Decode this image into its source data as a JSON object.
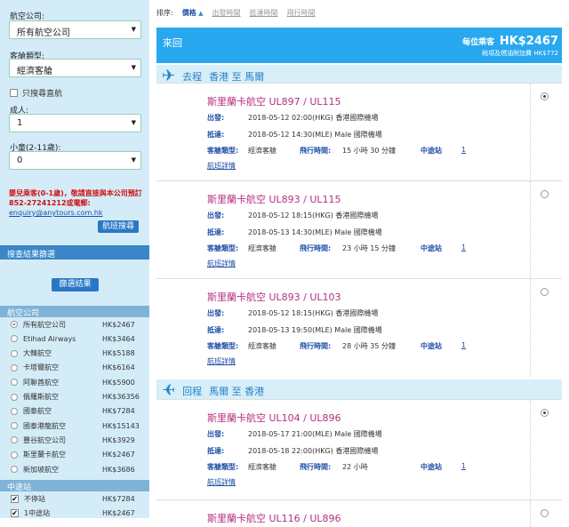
{
  "sidebar": {
    "airline_label": "航空公司:",
    "airline_value": "所有航空公司",
    "cabin_label": "客艙類型:",
    "cabin_value": "經濟客艙",
    "direct_only_label": "只搜尋直航",
    "adult_label": "成人:",
    "adult_value": "1",
    "child_label": "小童(2-11歲):",
    "child_value": "0",
    "notice_red": "嬰兒乘客(0-1歲)，敬請直接與本公司預訂852-27241212或電郵:",
    "notice_email": "enquiry@anytours.com.hk",
    "search_button": "航班搜尋",
    "filter_section_title": "搜查結果篩選",
    "filter_button": "篩選結果",
    "airline_section_title": "航空公司",
    "airlines": [
      {
        "name": "所有航空公司",
        "price": "HK$2467",
        "checked": true
      },
      {
        "name": "Etihad Airways",
        "price": "HK$3464",
        "checked": false
      },
      {
        "name": "大韓航空",
        "price": "HK$5188",
        "checked": false
      },
      {
        "name": "卡塔爾航空",
        "price": "HK$6164",
        "checked": false
      },
      {
        "name": "阿聯酋航空",
        "price": "HK$5900",
        "checked": false
      },
      {
        "name": "俄羅斯航空",
        "price": "HK$36356",
        "checked": false
      },
      {
        "name": "國泰航空",
        "price": "HK$7284",
        "checked": false
      },
      {
        "name": "國泰港龍航空",
        "price": "HK$15143",
        "checked": false
      },
      {
        "name": "豐谷航空公司",
        "price": "HK$3929",
        "checked": false
      },
      {
        "name": "斯里蘭卡航空",
        "price": "HK$2467",
        "checked": false
      },
      {
        "name": "新加坡航空",
        "price": "HK$3686",
        "checked": false
      }
    ],
    "stops_section_title": "中途站",
    "stops": [
      {
        "name": "不停站",
        "price": "HK$7284",
        "checked": true
      },
      {
        "name": "1中途站",
        "price": "HK$2467",
        "checked": true
      }
    ]
  },
  "sortbar": {
    "label": "排序:",
    "options": [
      "價格",
      "出發時間",
      "抵達時間",
      "飛行時間"
    ]
  },
  "header": {
    "title": "來回",
    "price_label": "每位乘客",
    "price": "HK$2467",
    "tax_note": "稅項及燃油附加費",
    "tax": "HK$772"
  },
  "outbound": {
    "label": "去程",
    "from": "香港",
    "to_word": "至",
    "to": "馬爾"
  },
  "inbound": {
    "label": "回程",
    "from": "馬爾",
    "to_word": "至",
    "to": "香港"
  },
  "labels": {
    "depart": "出發:",
    "arrive": "抵達:",
    "cabin": "客艙類型:",
    "duration": "飛行時間:",
    "stop": "中途站",
    "details": "航班詳情"
  },
  "flights": [
    {
      "name": "斯里蘭卡航空 UL897 / UL115",
      "depart": "2018-05-12 02:00(HKG) 香港國際機場",
      "arrive": "2018-05-12 14:30(MLE) Male 國際機場",
      "cabin": "經濟客艙",
      "duration": "15 小時 30 分鐘",
      "stops": "1",
      "selected": true
    },
    {
      "name": "斯里蘭卡航空 UL893 / UL115",
      "depart": "2018-05-12 18:15(HKG) 香港國際機場",
      "arrive": "2018-05-13 14:30(MLE) Male 國際機場",
      "cabin": "經濟客艙",
      "duration": "23 小時 15 分鐘",
      "stops": "1",
      "selected": false
    },
    {
      "name": "斯里蘭卡航空 UL893 / UL103",
      "depart": "2018-05-12 18:15(HKG) 香港國際機場",
      "arrive": "2018-05-13 19:50(MLE) Male 國際機場",
      "cabin": "經濟客艙",
      "duration": "28 小時 35 分鐘",
      "stops": "1",
      "selected": false
    },
    {
      "name": "斯里蘭卡航空 UL104 / UL896",
      "depart": "2018-05-17 21:00(MLE) Male 國際機場",
      "arrive": "2018-05-18 22:00(HKG) 香港國際機場",
      "cabin": "經濟客艙",
      "duration": "22 小時",
      "stops": "1",
      "selected": true
    },
    {
      "name": "斯里蘭卡航空 UL116 / UL896",
      "selected": false
    }
  ],
  "colors": {
    "accent": "#29a8ef",
    "sidebar_bg": "#d4ecf8",
    "flight_name": "#b4307f",
    "link": "#1d4fa6",
    "notice": "#d01010"
  }
}
